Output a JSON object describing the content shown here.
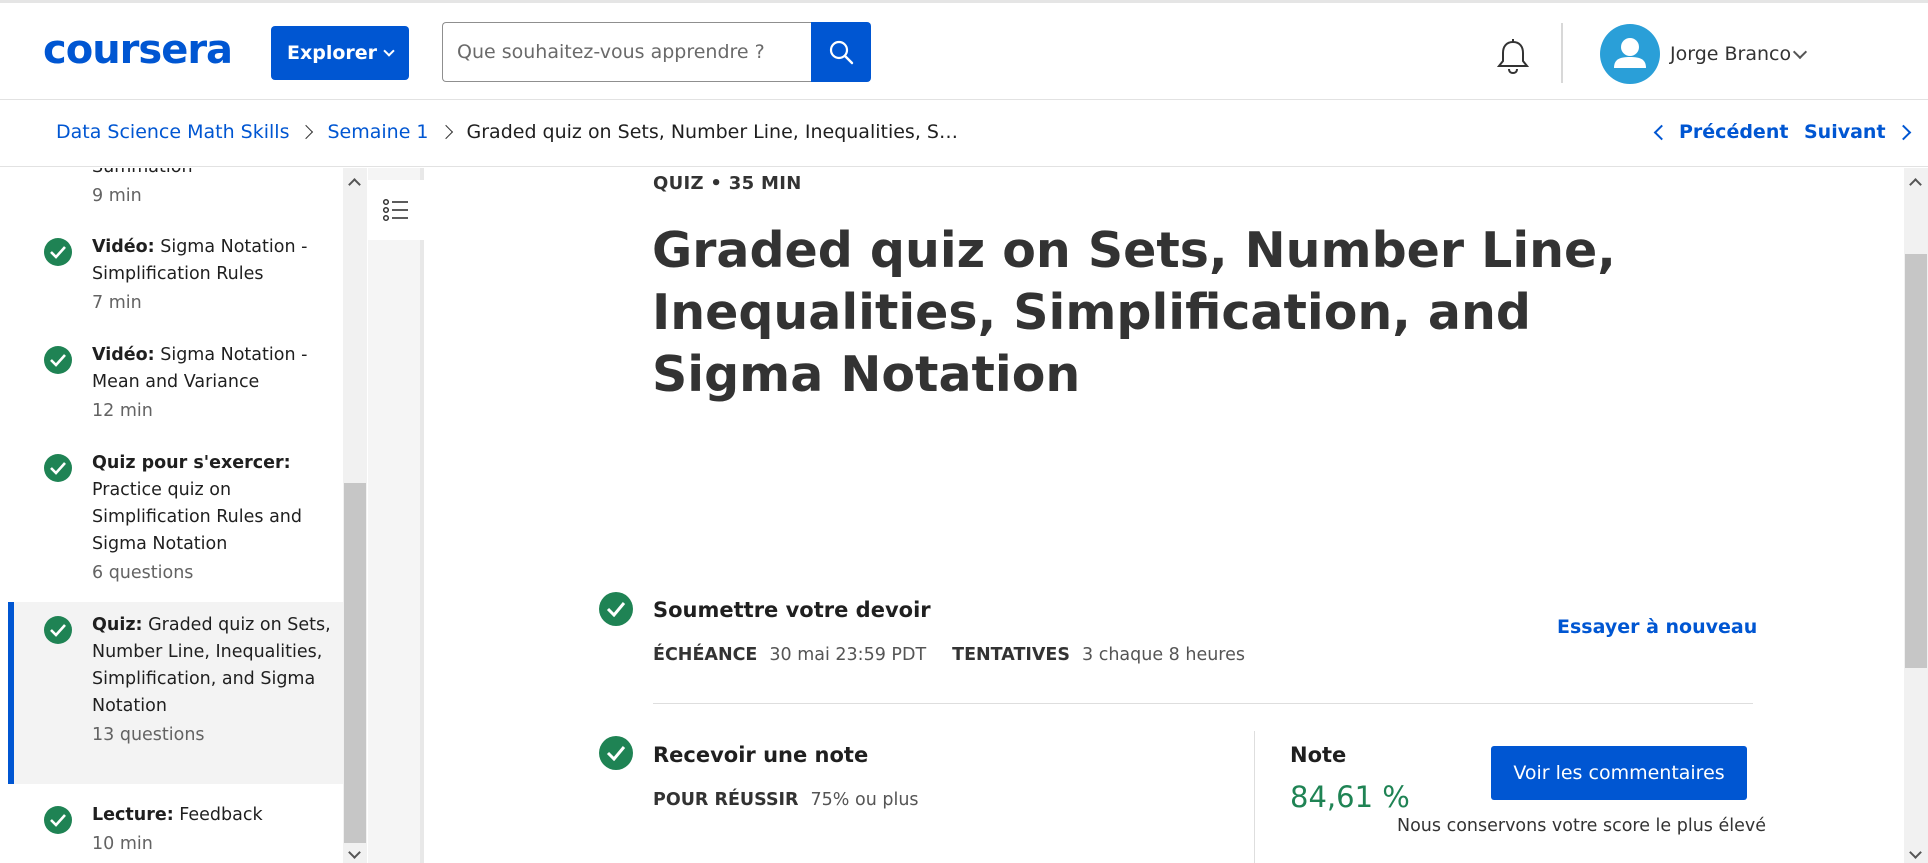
{
  "header": {
    "logo": "coursera",
    "explore_label": "Explorer",
    "search_placeholder": "Que souhaitez-vous apprendre ?",
    "user_name": "Jorge Branco"
  },
  "breadcrumb": {
    "course": "Data Science Math Skills",
    "week": "Semaine 1",
    "current": "Graded quiz on Sets, Number Line, Inequalities, S…",
    "prev_label": "Précédent",
    "next_label": "Suivant"
  },
  "sidebar": {
    "items": [
      {
        "partial_title": "Summation",
        "meta": "9 min"
      },
      {
        "type": "Vidéo:",
        "title": " Sigma Notation - Simplification Rules",
        "meta": "7 min"
      },
      {
        "type": "Vidéo:",
        "title": " Sigma Notation - Mean and Variance",
        "meta": "12 min"
      },
      {
        "type": "Quiz pour s'exercer:",
        "title": " Practice quiz on Simplification Rules and Sigma Notation",
        "meta": "6 questions"
      },
      {
        "type": "Quiz:",
        "title": " Graded quiz on Sets, Number Line, Inequalities, Simplification, and Sigma Notation",
        "meta": "13 questions"
      },
      {
        "type": "Lecture:",
        "title": " Feedback",
        "meta": "10 min"
      }
    ]
  },
  "main": {
    "label": "QUIZ • 35 MIN",
    "title": "Graded quiz on Sets, Number Line, Inequalities, Simplification, and Sigma Notation",
    "submit": {
      "title": "Soumettre votre devoir",
      "deadline_key": "ÉCHÉANCE",
      "deadline_value": "30 mai 23:59 PDT",
      "attempts_key": "TENTATIVES",
      "attempts_value": "3 chaque 8 heures",
      "retry_label": "Essayer à nouveau"
    },
    "grade": {
      "title": "Recevoir une note",
      "pass_key": "POUR RÉUSSIR",
      "pass_value": "75% ou plus",
      "note_label": "Note",
      "note_value": "84,61 %",
      "feedback_label": "Voir les commentaires",
      "keep_note": "Nous conservons votre score le plus élevé"
    }
  },
  "colors": {
    "brand_blue": "#0056d2",
    "success_green": "#1f8354"
  }
}
